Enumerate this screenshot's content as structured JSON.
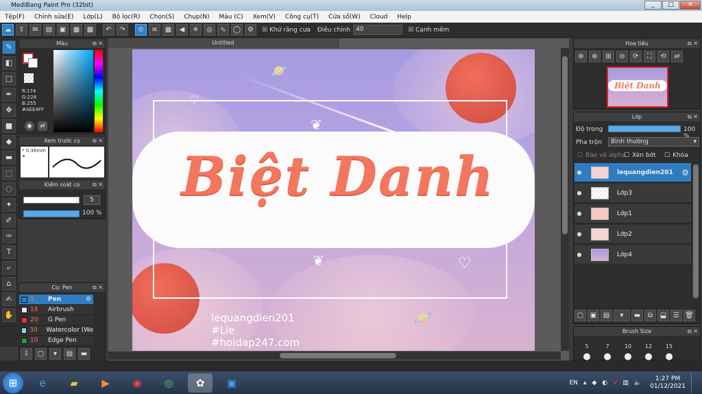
{
  "window": {
    "title": "MediBang Paint Pro (32bit)",
    "minimize": "_",
    "maximize": "□",
    "close": "✕"
  },
  "menu": [
    "Tệp(F)",
    "Chỉnh sửa(E)",
    "Lớp(L)",
    "Bộ lọc(R)",
    "Chọn(S)",
    "Chụp(N)",
    "Màu (C)",
    "Xem(V)",
    "Công cụ(T)",
    "Cửa sổ(W)",
    "Cloud",
    "Help"
  ],
  "toolbar": {
    "antialias_label": "Khử răng cưa",
    "adjust_label": "Điều chỉnh",
    "adjust_value": "40",
    "sharp_label": "Cạnh mềm"
  },
  "color_panel": {
    "title": "Màu",
    "r": "R:174",
    "g": "G:228",
    "b": "B:255",
    "hex": "#AEE4FF"
  },
  "brush_preview": {
    "title": "Xem trước cọ",
    "size": "0.36mm"
  },
  "brush_control": {
    "title": "Kiểm soát cọ",
    "size_value": "5",
    "opacity_value": "100 %"
  },
  "brush_list": {
    "title": "Cọ: Pen",
    "items": [
      {
        "size": "5",
        "name": "Pen",
        "color": "#2f7dc1"
      },
      {
        "size": "18",
        "name": "Airbrush",
        "color": "#e8e8e8"
      },
      {
        "size": "20",
        "name": "G Pen",
        "color": "#e33"
      },
      {
        "size": "30",
        "name": "Watercolor (Wet)",
        "color": "#8ad0f0"
      },
      {
        "size": "10",
        "name": "Edge Pen",
        "color": "#28a028"
      }
    ]
  },
  "canvas": {
    "tab": "Untitled",
    "title_text": "Biệt Danh",
    "credit1": "lequangdien201",
    "credit2": "#Lie",
    "credit3": "#hoidap247.com"
  },
  "navigator": {
    "title": "Hoa tiêu"
  },
  "layers": {
    "title": "Lớp",
    "opacity_label": "Độ trong",
    "opacity_value": "100 %",
    "blend_label": "Pha trộn",
    "blend_value": "Bình thường",
    "protect_alpha": "Bảo vệ alpha",
    "clip": "Xén bớt",
    "lock": "Khóa",
    "items": [
      {
        "name": "lequangdien201"
      },
      {
        "name": "Lớp3"
      },
      {
        "name": "Lớp1"
      },
      {
        "name": "Lớp2"
      },
      {
        "name": "Lớp4"
      }
    ]
  },
  "brush_size": {
    "title": "Brush Size",
    "sizes": [
      "5",
      "7",
      "10",
      "12",
      "15"
    ]
  },
  "taskbar": {
    "lang": "EN",
    "time": "1:27 PM",
    "date": "01/12/2021"
  }
}
